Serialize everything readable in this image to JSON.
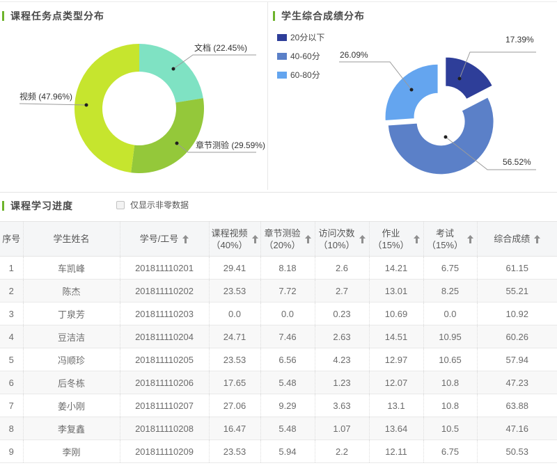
{
  "chart_data": [
    {
      "type": "pie",
      "title": "课程任务点类型分布",
      "donut": true,
      "labels": [
        "文档",
        "章节测验",
        "视频"
      ],
      "values": [
        22.45,
        29.59,
        47.96
      ],
      "unit": "%",
      "colors": [
        "#7fe2c3",
        "#94c83a",
        "#c6e52e"
      ],
      "legend_position": "none",
      "callouts": {
        "doc": "文档 (22.45%)",
        "quiz": "章节测验 (29.59%)",
        "video": "视频 (47.96%)"
      }
    },
    {
      "type": "pie",
      "title": "学生综合成绩分布",
      "donut": true,
      "labels": [
        "20分以下",
        "40-60分",
        "60-80分"
      ],
      "values": [
        17.39,
        56.52,
        26.09
      ],
      "unit": "%",
      "colors": [
        "#2e3e99",
        "#5b80c8",
        "#64a5ef"
      ],
      "legend_position": "top-left",
      "callouts": {
        "low": "17.39%",
        "mid": "56.52%",
        "high": "26.09%"
      }
    }
  ],
  "progress_section": {
    "title": "课程学习进度",
    "filter_checkbox_label": "仅显示非零数据",
    "checkbox_checked": false
  },
  "table": {
    "headers": [
      {
        "line1": "序号",
        "line2": "",
        "sortable": false
      },
      {
        "line1": "学生姓名",
        "line2": "",
        "sortable": false
      },
      {
        "line1": "学号/工号",
        "line2": "",
        "sortable": true
      },
      {
        "line1": "课程视频",
        "line2": "（40%）",
        "sortable": true
      },
      {
        "line1": "章节测验",
        "line2": "（20%）",
        "sortable": true
      },
      {
        "line1": "访问次数",
        "line2": "（10%）",
        "sortable": true
      },
      {
        "line1": "作业",
        "line2": "（15%）",
        "sortable": true
      },
      {
        "line1": "考试",
        "line2": "（15%）",
        "sortable": true
      },
      {
        "line1": "综合成绩",
        "line2": "",
        "sortable": true
      }
    ],
    "rows": [
      [
        "1",
        "车凯峰",
        "201811110201",
        "29.41",
        "8.18",
        "2.6",
        "14.21",
        "6.75",
        "61.15"
      ],
      [
        "2",
        "陈杰",
        "201811110202",
        "23.53",
        "7.72",
        "2.7",
        "13.01",
        "8.25",
        "55.21"
      ],
      [
        "3",
        "丁泉芳",
        "201811110203",
        "0.0",
        "0.0",
        "0.23",
        "10.69",
        "0.0",
        "10.92"
      ],
      [
        "4",
        "豆洁洁",
        "201811110204",
        "24.71",
        "7.46",
        "2.63",
        "14.51",
        "10.95",
        "60.26"
      ],
      [
        "5",
        "冯顺珍",
        "201811110205",
        "23.53",
        "6.56",
        "4.23",
        "12.97",
        "10.65",
        "57.94"
      ],
      [
        "6",
        "后冬栋",
        "201811110206",
        "17.65",
        "5.48",
        "1.23",
        "12.07",
        "10.8",
        "47.23"
      ],
      [
        "7",
        "姜小刚",
        "201811110207",
        "27.06",
        "9.29",
        "3.63",
        "13.1",
        "10.8",
        "63.88"
      ],
      [
        "8",
        "李复鑫",
        "201811110208",
        "16.47",
        "5.48",
        "1.07",
        "13.64",
        "10.5",
        "47.16"
      ],
      [
        "9",
        "李刚",
        "201811110209",
        "23.53",
        "5.94",
        "2.2",
        "12.11",
        "6.75",
        "50.53"
      ]
    ]
  }
}
